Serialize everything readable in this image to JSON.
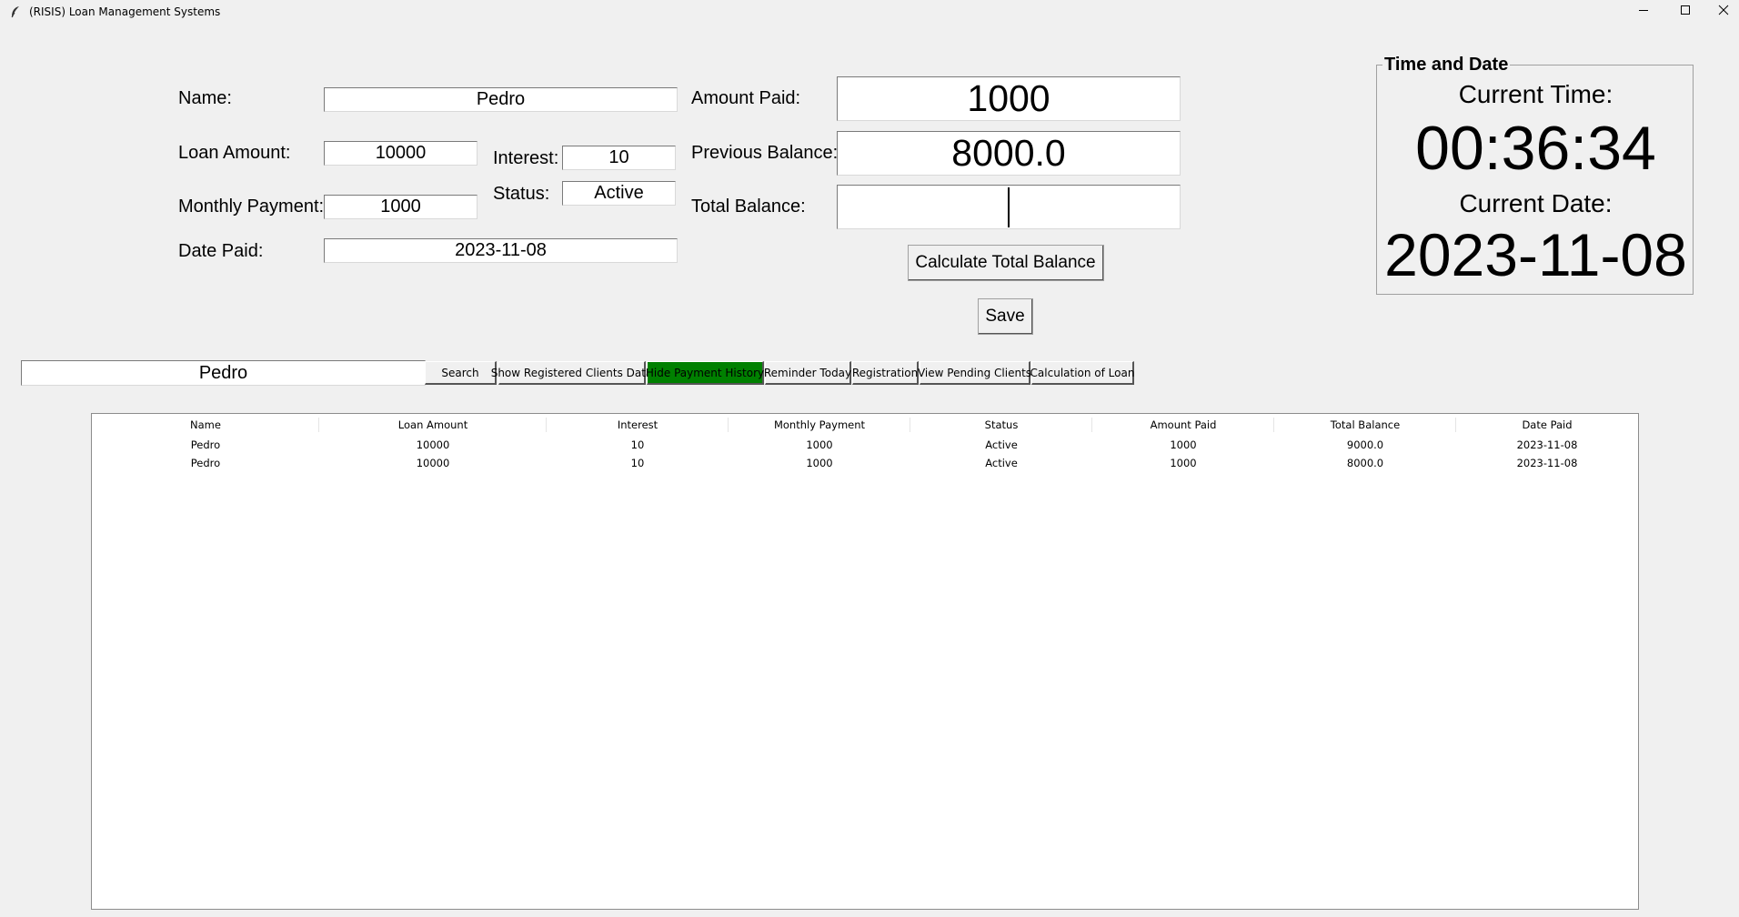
{
  "window": {
    "title": "(RISIS) Loan Management Systems"
  },
  "form": {
    "name_label": "Name:",
    "name_value": "Pedro",
    "loan_amount_label": "Loan Amount:",
    "loan_amount_value": "10000",
    "interest_label": "Interest:",
    "interest_value": "10",
    "monthly_payment_label": "Monthly Payment:",
    "monthly_payment_value": "1000",
    "status_label": "Status:",
    "status_value": "Active",
    "date_paid_label": "Date Paid:",
    "date_paid_value": "2023-11-08",
    "amount_paid_label": "Amount Paid:",
    "amount_paid_value": "1000",
    "previous_balance_label": "Previous Balance:",
    "previous_balance_value": "8000.0",
    "total_balance_label": "Total Balance:",
    "total_balance_value": "",
    "calculate_button": "Calculate Total Balance",
    "save_button": "Save"
  },
  "clock": {
    "group_title": "Time and Date",
    "time_label": "Current Time:",
    "time_value": "00:36:34",
    "date_label": "Current Date:",
    "date_value": "2023-11-08"
  },
  "search": {
    "value": "Pedro",
    "button": "Search"
  },
  "toolbar": {
    "show_registered": "Show Registered Clients Data",
    "hide_payment_history": "Hide Payment History",
    "reminder_today": "Reminder Today",
    "registration": "Registration",
    "view_pending": "View Pending Clients",
    "calculation_of_loan": "Calculation of Loan",
    "active_color": "#008000"
  },
  "table": {
    "columns": [
      "Name",
      "Loan Amount",
      "Interest",
      "Monthly Payment",
      "Status",
      "Amount Paid",
      "Total Balance",
      "Date Paid"
    ],
    "rows": [
      [
        "Pedro",
        "10000",
        "10",
        "1000",
        "Active",
        "1000",
        "9000.0",
        "2023-11-08"
      ],
      [
        "Pedro",
        "10000",
        "10",
        "1000",
        "Active",
        "1000",
        "8000.0",
        "2023-11-08"
      ]
    ]
  }
}
